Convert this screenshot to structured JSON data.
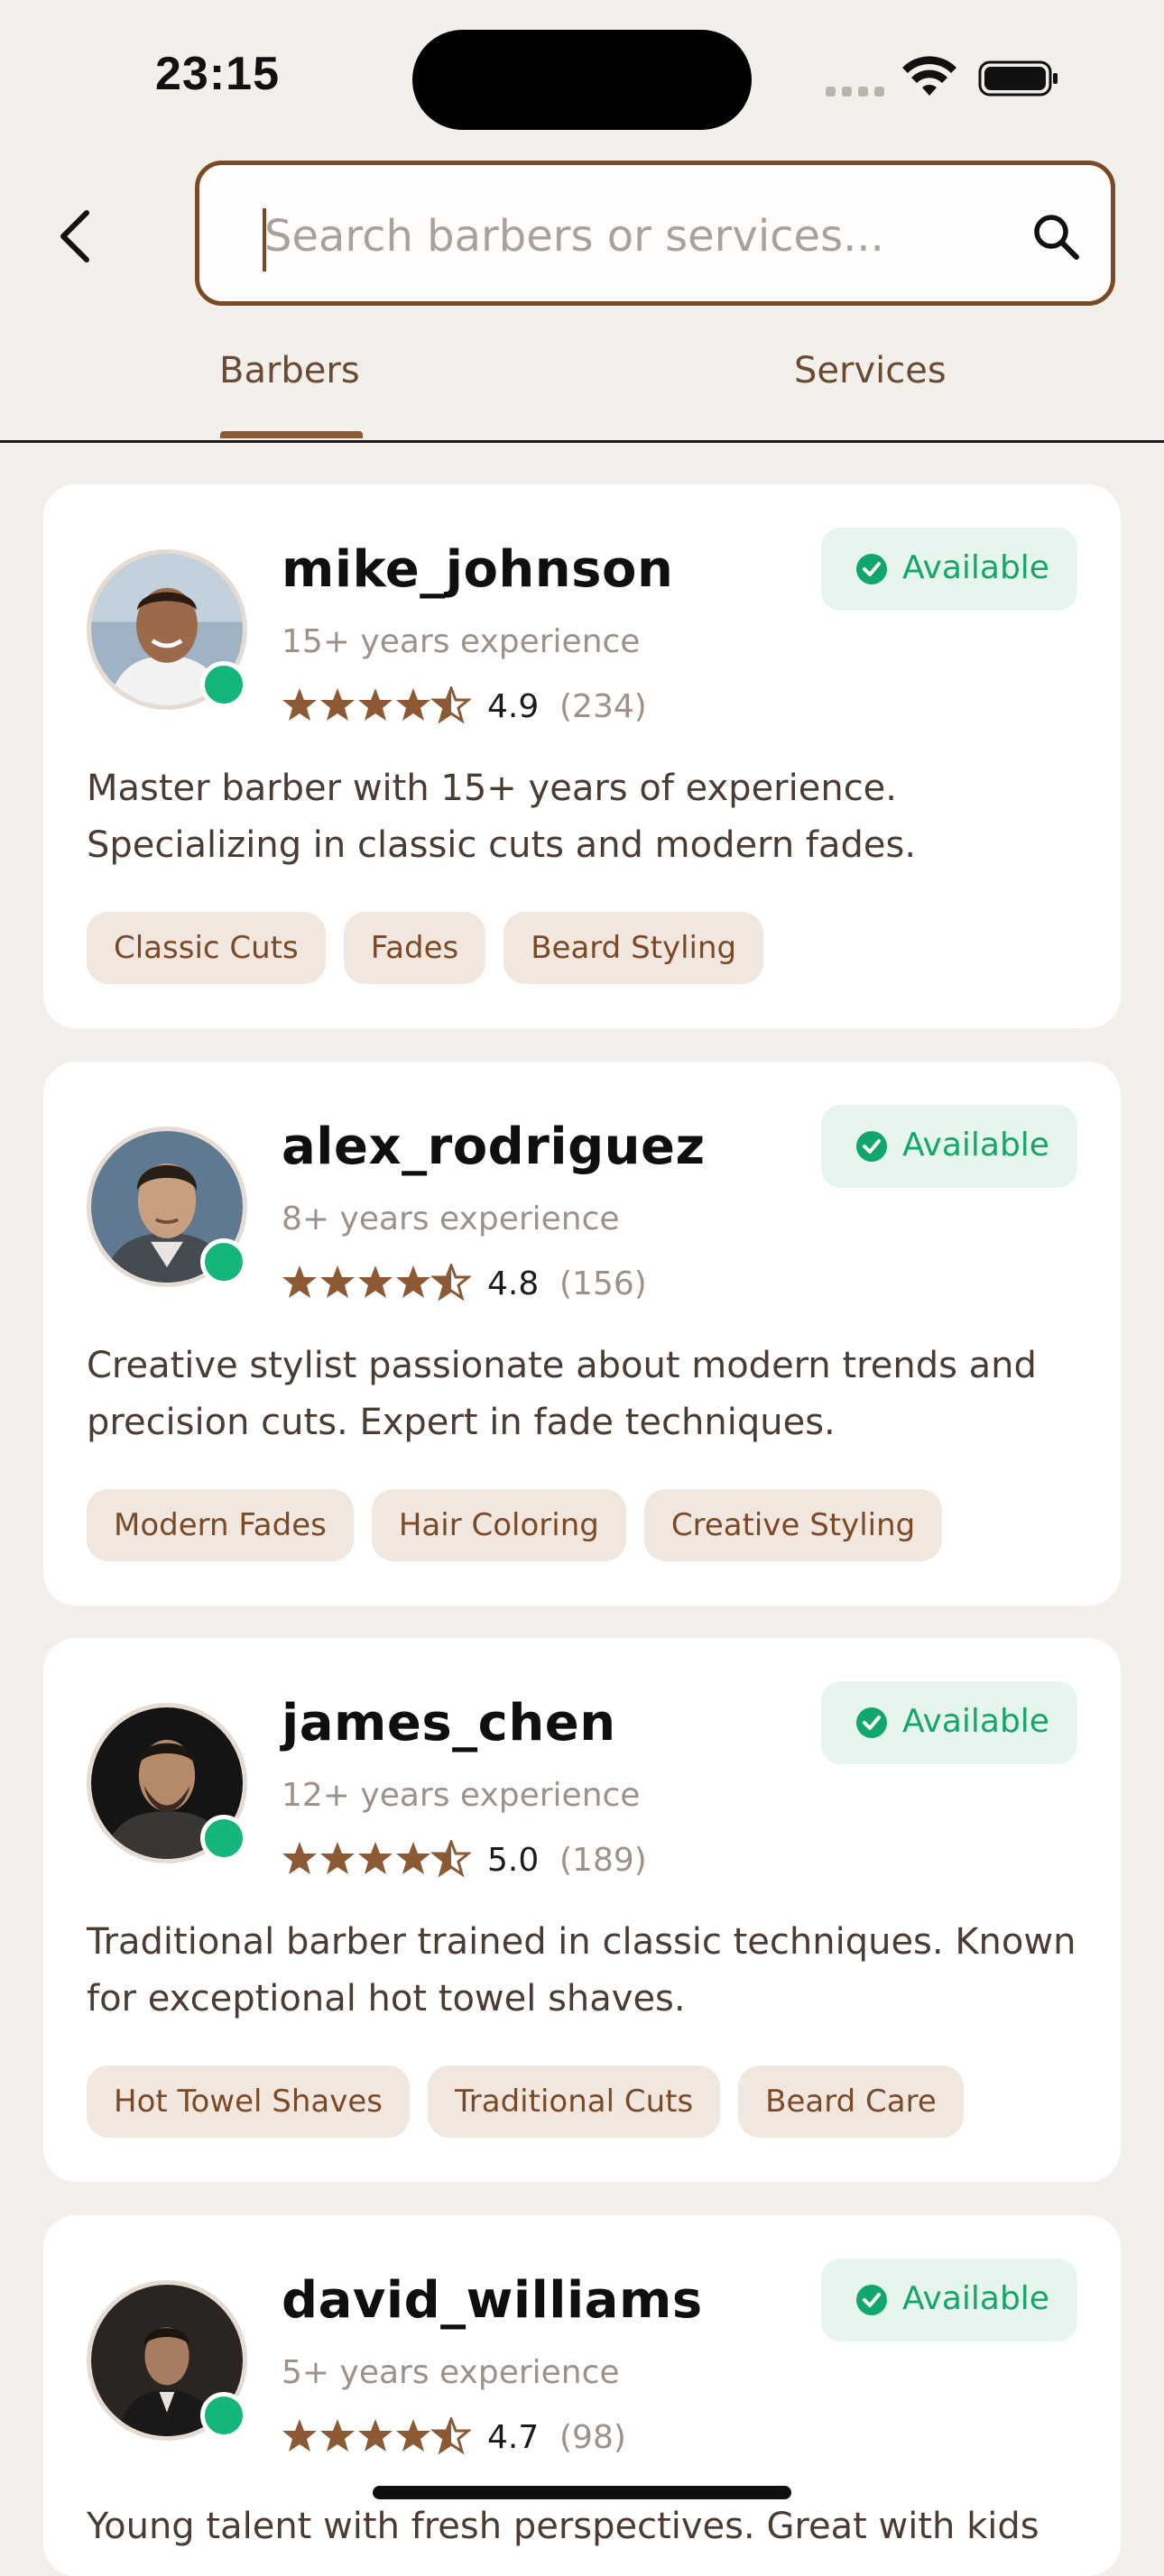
{
  "status_bar": {
    "time": "23:15"
  },
  "search": {
    "placeholder": "Search barbers or services..."
  },
  "tabs": [
    {
      "label": "Barbers",
      "active": true
    },
    {
      "label": "Services",
      "active": false
    }
  ],
  "barbers": [
    {
      "username": "mike_johnson",
      "experience": "15+ years experience",
      "rating": "4.9",
      "review_count": "(234)",
      "status": "Available",
      "bio": "Master barber with 15+ years of experience. Specializing in classic cuts and modern fades.",
      "tags": [
        "Classic Cuts",
        "Fades",
        "Beard Styling"
      ]
    },
    {
      "username": "alex_rodriguez",
      "experience": "8+ years experience",
      "rating": "4.8",
      "review_count": "(156)",
      "status": "Available",
      "bio": "Creative stylist passionate about modern trends and precision cuts. Expert in fade techniques.",
      "tags": [
        "Modern Fades",
        "Hair Coloring",
        "Creative Styling"
      ]
    },
    {
      "username": "james_chen",
      "experience": "12+ years experience",
      "rating": "5.0",
      "review_count": "(189)",
      "status": "Available",
      "bio": "Traditional barber trained in classic techniques. Known for exceptional hot towel shaves.",
      "tags": [
        "Hot Towel Shaves",
        "Traditional Cuts",
        "Beard Care"
      ]
    },
    {
      "username": "david_williams",
      "experience": "5+ years experience",
      "rating": "4.7",
      "review_count": "(98)",
      "status": "Available",
      "bio": "Young talent with fresh perspectives. Great with kids",
      "tags": []
    }
  ],
  "colors": {
    "accent": "#7a4a27",
    "available_green": "#15b67c",
    "background": "#f3efea",
    "star": "#8b5a35"
  },
  "icons": {
    "back": "chevron-left-icon",
    "search": "search-icon",
    "available": "check-circle-icon",
    "star": "star-icon"
  }
}
